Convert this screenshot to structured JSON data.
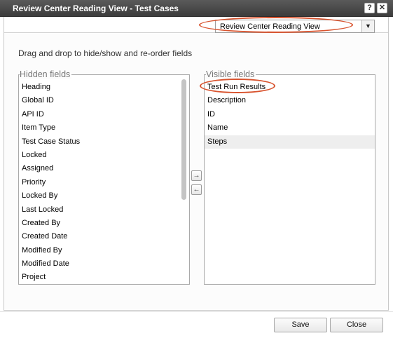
{
  "window": {
    "title": "Review Center Reading View - Test Cases",
    "help_label": "?",
    "close_label": "✕"
  },
  "view_select": {
    "value": "Review Center Reading View",
    "arrow": "▼"
  },
  "instruction": "Drag and drop to hide/show and re-order fields",
  "hidden_fields": {
    "label": "Hidden fields",
    "items": [
      "Heading",
      "Global ID",
      "API ID",
      "Item Type",
      "Test Case Status",
      "Locked",
      "Assigned",
      "Priority",
      "Locked By",
      "Last Locked",
      "Created By",
      "Created Date",
      "Modified By",
      "Modified Date",
      "Project"
    ]
  },
  "visible_fields": {
    "label": "Visible fields",
    "items": [
      "Test Run Results",
      "Description",
      "ID",
      "Name",
      "Steps"
    ],
    "selected_item": "Steps"
  },
  "move_buttons": {
    "right": "→",
    "left": "←"
  },
  "footer": {
    "save_label": "Save",
    "close_label": "Close"
  },
  "colors": {
    "highlight": "#d8532e",
    "titlebar": "#4a4a4a"
  }
}
